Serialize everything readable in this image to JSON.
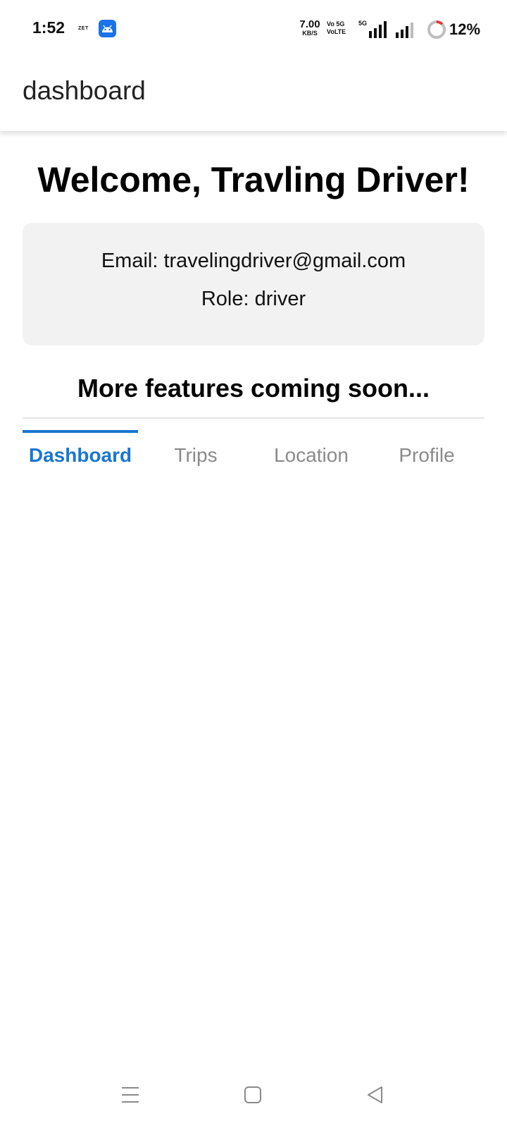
{
  "status_bar": {
    "time": "1:52",
    "small_icon_text": "ZET",
    "app_icon": "android-icon",
    "net_speed_value": "7.00",
    "net_speed_unit": "KB/S",
    "volte_line1": "Vo 5G",
    "volte_line2": "VoLTE",
    "network_type": "5G",
    "battery_percent": "12%"
  },
  "app_bar": {
    "title": "dashboard"
  },
  "main": {
    "welcome": "Welcome, Travling Driver!",
    "email_line": "Email: travelingdriver@gmail.com",
    "role_line": "Role: driver",
    "coming_soon": "More features coming soon..."
  },
  "tabs": [
    {
      "label": "Dashboard",
      "active": true
    },
    {
      "label": "Trips",
      "active": false
    },
    {
      "label": "Location",
      "active": false
    },
    {
      "label": "Profile",
      "active": false
    }
  ],
  "nav_bar": {
    "icons": [
      "menu-icon",
      "home-square-icon",
      "back-triangle-icon"
    ]
  },
  "colors": {
    "accent": "#1976d2",
    "inactive_tab": "#8a8a8a",
    "card_bg": "#f2f2f2"
  }
}
